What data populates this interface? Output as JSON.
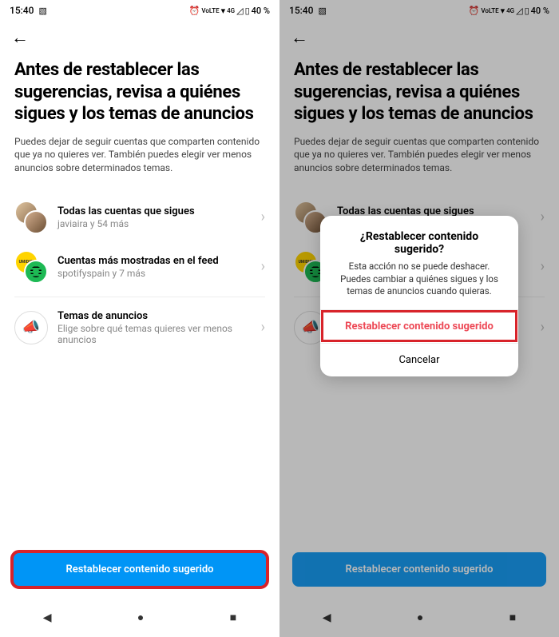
{
  "status": {
    "time": "15:40",
    "icons": "⏰ ⩊ᴸᵀᴱ ▼⁴ᴳ ◿ 🔋",
    "battery": "40 %"
  },
  "header": {
    "title": "Antes de restablecer las sugerencias, revisa a quiénes sigues y los temas de anuncios",
    "subtitle": "Puedes dejar de seguir cuentas que comparten contenido que ya no quieres ver. También puedes elegir ver menos anuncios sobre determinados temas."
  },
  "items": {
    "accounts": {
      "title": "Todas las cuentas que sigues",
      "sub": "javiaira y 54 más"
    },
    "feed": {
      "title": "Cuentas más mostradas en el feed",
      "sub": "spotifyspain y 7 más"
    },
    "ads": {
      "title": "Temas de anuncios",
      "sub": "Elige sobre qué temas quieres ver menos anuncios"
    }
  },
  "primary_button": "Restablecer contenido sugerido",
  "modal": {
    "title": "¿Restablecer contenido sugerido?",
    "text": "Esta acción no se puede deshacer. Puedes cambiar a quiénes sigues y los temas de anuncios cuando quieras.",
    "confirm": "Restablecer contenido sugerido",
    "cancel": "Cancelar"
  }
}
